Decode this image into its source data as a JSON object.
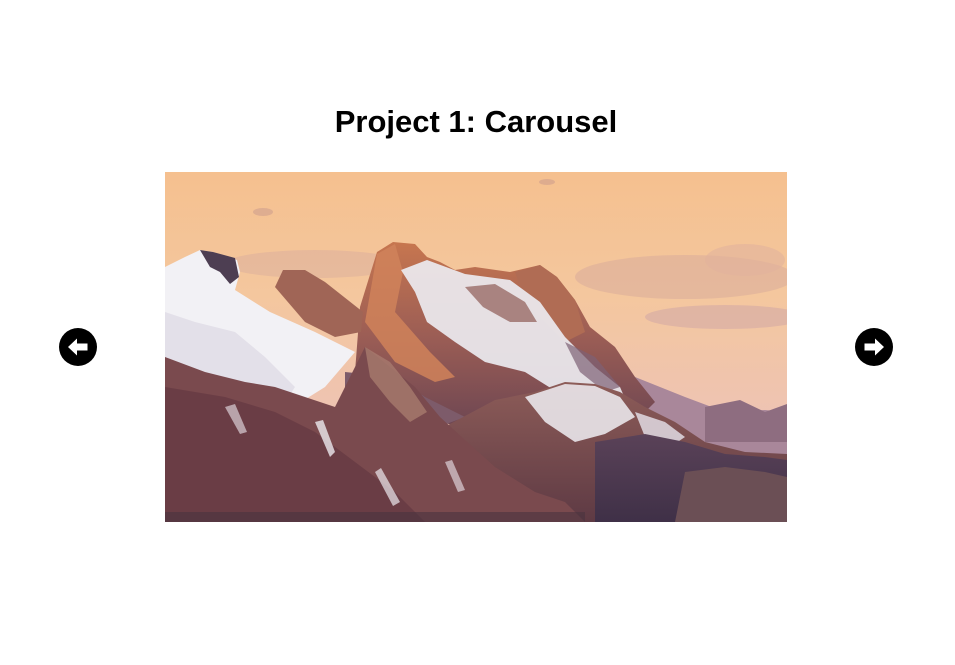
{
  "page": {
    "title": "Project 1: Carousel"
  },
  "carousel": {
    "prev_icon": "arrow-left-icon",
    "next_icon": "arrow-right-icon",
    "slide_subject": "snow-capped mountain range at sunset"
  },
  "colors": {
    "background": "#ffffff",
    "title_text": "#000000",
    "nav_button": "#000000",
    "nav_arrow": "#ffffff"
  }
}
